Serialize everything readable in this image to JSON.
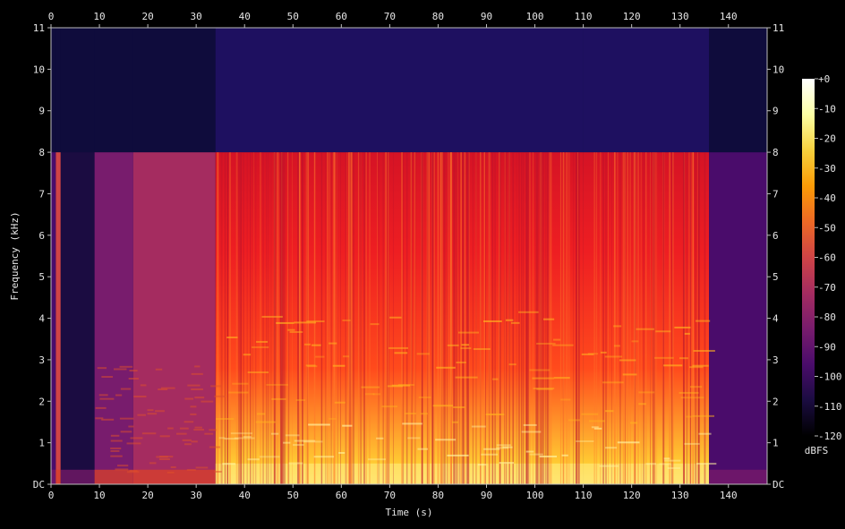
{
  "chart_data": {
    "type": "heatmap",
    "title": "",
    "xlabel": "Time (s)",
    "ylabel": "Frequency (kHz)",
    "xlim": [
      0,
      148
    ],
    "ylim": [
      0,
      11
    ],
    "x_ticks": [
      0,
      10,
      20,
      30,
      40,
      50,
      60,
      70,
      80,
      90,
      100,
      110,
      120,
      130,
      140
    ],
    "y_ticks": [
      "DC",
      "1",
      "2",
      "3",
      "4",
      "5",
      "6",
      "7",
      "8",
      "9",
      "10",
      "11"
    ],
    "colorbar": {
      "label": "dBFS",
      "range": [
        -120,
        0
      ],
      "ticks": [
        "+0",
        "-10",
        "-20",
        "-30",
        "-40",
        "-50",
        "-60",
        "-70",
        "-80",
        "-90",
        "-100",
        "-110",
        "-120"
      ],
      "colormap": [
        "#000000",
        "#1b0c41",
        "#4a0c6b",
        "#781c6d",
        "#a52c60",
        "#cf4446",
        "#ed6925",
        "#fb9b06",
        "#f7d13d",
        "#fcffa4",
        "#ffffff"
      ]
    },
    "segments": [
      {
        "start": 0,
        "end": 1,
        "level_db": -95,
        "cutoff_khz": 8.0
      },
      {
        "start": 1,
        "end": 2,
        "level_db": -60,
        "cutoff_khz": 8.0
      },
      {
        "start": 2,
        "end": 9,
        "level_db": -110,
        "cutoff_khz": 8.0
      },
      {
        "start": 9,
        "end": 17,
        "level_db": -85,
        "cutoff_khz": 8.0
      },
      {
        "start": 17,
        "end": 34,
        "level_db": -78,
        "cutoff_khz": 8.0
      },
      {
        "start": 34,
        "end": 110,
        "level_db": -50,
        "cutoff_khz": 8.0
      },
      {
        "start": 110,
        "end": 136,
        "level_db": -52,
        "cutoff_khz": 8.0
      },
      {
        "start": 136,
        "end": 148,
        "level_db": -100,
        "cutoff_khz": 8.0
      }
    ],
    "grid": false,
    "legend": "none"
  }
}
